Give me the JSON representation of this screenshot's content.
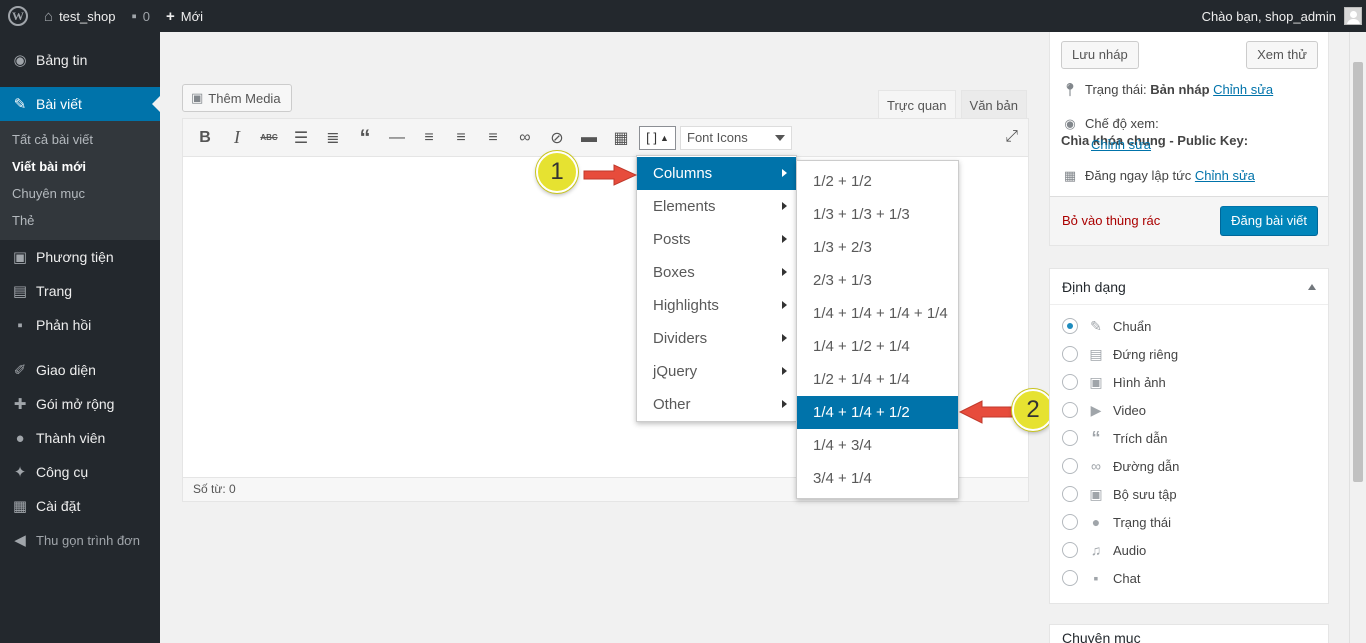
{
  "adminbar": {
    "site_name": "test_shop",
    "comments_count": "0",
    "new_label": "Mới",
    "greeting": "Chào bạn, shop_admin"
  },
  "sidebar": {
    "dashboard": "Bảng tin",
    "posts": "Bài viết",
    "submenu": [
      "Tất cả bài viết",
      "Viết bài mới",
      "Chuyên mục",
      "Thẻ"
    ],
    "media": "Phương tiện",
    "pages": "Trang",
    "comments": "Phản hồi",
    "appearance": "Giao diện",
    "plugins": "Gói mở rộng",
    "users": "Thành viên",
    "tools": "Công cụ",
    "settings": "Cài đặt",
    "collapse": "Thu gọn trình đơn"
  },
  "editor": {
    "add_media": "Thêm Media",
    "tab_visual": "Trực quan",
    "tab_text": "Văn bản",
    "shortcode_button": "[ ]",
    "font_icons": "Font Icons",
    "word_count": "Số từ: 0"
  },
  "shortcode_menu": {
    "items": [
      "Columns",
      "Elements",
      "Posts",
      "Boxes",
      "Highlights",
      "Dividers",
      "jQuery",
      "Other"
    ],
    "active": "Columns"
  },
  "columns_menu": {
    "items": [
      "1/2 + 1/2",
      "1/3 + 1/3 + 1/3",
      "1/3 + 2/3",
      "2/3 + 1/3",
      "1/4 + 1/4 + 1/4 + 1/4",
      "1/4 + 1/2 + 1/4",
      "1/2 + 1/4 + 1/4",
      "1/4 + 1/4 + 1/2",
      "1/4 + 3/4",
      "3/4 + 1/4"
    ],
    "active": "1/4 + 1/4 + 1/2"
  },
  "callouts": [
    "1",
    "2"
  ],
  "publish": {
    "save_draft": "Lưu nháp",
    "preview": "Xem thử",
    "status_label": "Trạng thái:",
    "status_value": "Bản nháp",
    "edit": "Chỉnh sửa",
    "visibility_label": "Chế độ xem:",
    "visibility_value": "Chìa khóa chung - Public Key:",
    "publish_label": "Đăng",
    "publish_value": "ngay lập tức",
    "trash": "Bỏ vào thùng rác",
    "publish_button": "Đăng bài viết"
  },
  "format": {
    "title": "Định dạng",
    "options": [
      "Chuẩn",
      "Đứng riêng",
      "Hình ảnh",
      "Video",
      "Trích dẫn",
      "Đường dẫn",
      "Bộ sưu tập",
      "Trạng thái",
      "Audio",
      "Chat"
    ],
    "selected": "Chuẩn"
  },
  "categories_box": {
    "title": "Chuyên mục"
  },
  "colors": {
    "accent": "#0073aa",
    "sidebar": "#23282d",
    "callout": "#e6e231",
    "arrow": "#e74c3c"
  }
}
